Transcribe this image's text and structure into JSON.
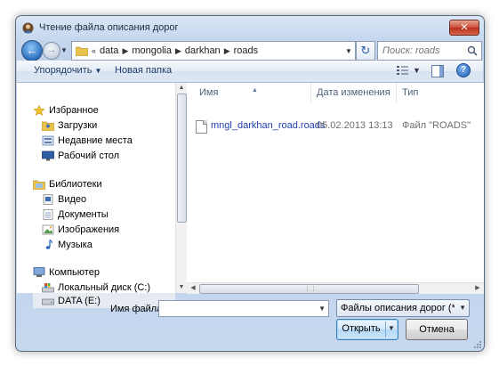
{
  "window": {
    "title": "Чтение файла описания дорог",
    "close_label": "✕"
  },
  "address": {
    "overflow": "«",
    "crumbs": [
      "data",
      "mongolia",
      "darkhan",
      "roads"
    ]
  },
  "search": {
    "placeholder": "Поиск: roads"
  },
  "toolbar": {
    "organize_label": "Упорядочить",
    "new_folder_label": "Новая папка"
  },
  "nav": {
    "favorites": "Избранное",
    "downloads": "Загрузки",
    "recent": "Недавние места",
    "desktop": "Рабочий стол",
    "libraries": "Библиотеки",
    "video": "Видео",
    "documents": "Документы",
    "pictures": "Изображения",
    "music": "Музыка",
    "computer": "Компьютер",
    "local_disk": "Локальный диск (C:)",
    "data_disk": "DATA (E:)"
  },
  "columns": {
    "name": "Имя",
    "date": "Дата изменения",
    "type": "Тип"
  },
  "files": [
    {
      "name": "mngl_darkhan_road.roads",
      "date": "05.02.2013 13:13",
      "type": "Файл \"ROADS\""
    }
  ],
  "bottom": {
    "filename_label": "Имя файла:",
    "filename_value": "",
    "filetype_value": "Файлы описания дорог (*.roads)",
    "open_label": "Открыть",
    "cancel_label": "Отмена"
  },
  "colors": {
    "accent": "#1f3fae",
    "window_frame": "#c3d6ec",
    "close_button": "#c94d39"
  }
}
